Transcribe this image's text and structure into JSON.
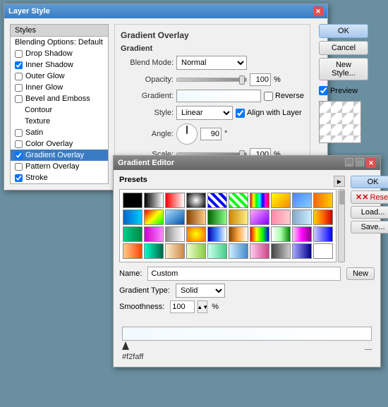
{
  "layerStyleWindow": {
    "title": "Layer Style",
    "sidebar": {
      "header": "Styles",
      "blendingOptions": "Blending Options: Default",
      "items": [
        {
          "id": "drop-shadow",
          "label": "Drop Shadow",
          "checked": false
        },
        {
          "id": "inner-shadow",
          "label": "Inner Shadow",
          "checked": true
        },
        {
          "id": "outer-glow",
          "label": "Outer Glow",
          "checked": false
        },
        {
          "id": "inner-glow",
          "label": "Inner Glow",
          "checked": false
        },
        {
          "id": "bevel-emboss",
          "label": "Bevel and Emboss",
          "checked": false
        },
        {
          "id": "contour",
          "label": "Contour",
          "checked": false,
          "sub": true
        },
        {
          "id": "texture",
          "label": "Texture",
          "checked": false,
          "sub": true
        },
        {
          "id": "satin",
          "label": "Satin",
          "checked": false
        },
        {
          "id": "color-overlay",
          "label": "Color Overlay",
          "checked": false
        },
        {
          "id": "gradient-overlay",
          "label": "Gradient Overlay",
          "checked": true,
          "active": true
        },
        {
          "id": "pattern-overlay",
          "label": "Pattern Overlay",
          "checked": false
        },
        {
          "id": "stroke",
          "label": "Stroke",
          "checked": true
        }
      ]
    },
    "buttons": {
      "ok": "OK",
      "cancel": "Cancel",
      "newStyle": "New Style...",
      "preview": "Preview"
    }
  },
  "gradientOverlay": {
    "title": "Gradient Overlay",
    "subtitle": "Gradient",
    "blendMode": {
      "label": "Blend Mode:",
      "value": "Normal"
    },
    "opacity": {
      "label": "Opacity:",
      "value": "100",
      "unit": "%"
    },
    "gradient": {
      "label": "Gradient:",
      "reverse": "Reverse"
    },
    "style": {
      "label": "Style:",
      "value": "Linear",
      "alignWithLayer": "Align with Layer"
    },
    "angle": {
      "label": "Angle:",
      "value": "90",
      "unit": "°"
    },
    "scale": {
      "label": "Scale:",
      "value": "100",
      "unit": "%"
    }
  },
  "gradientEditor": {
    "title": "Gradient Editor",
    "presetsLabel": "Presets",
    "buttons": {
      "ok": "OK",
      "reset": "Reset",
      "load": "Load...",
      "save": "Save..."
    },
    "name": {
      "label": "Name:",
      "value": "Custom"
    },
    "gradientType": {
      "label": "Gradient Type:",
      "value": "Solid"
    },
    "smoothness": {
      "label": "Smoothness:",
      "value": "100",
      "unit": "%"
    },
    "newButton": "New",
    "colorStop": {
      "value": "#f2faff"
    }
  }
}
